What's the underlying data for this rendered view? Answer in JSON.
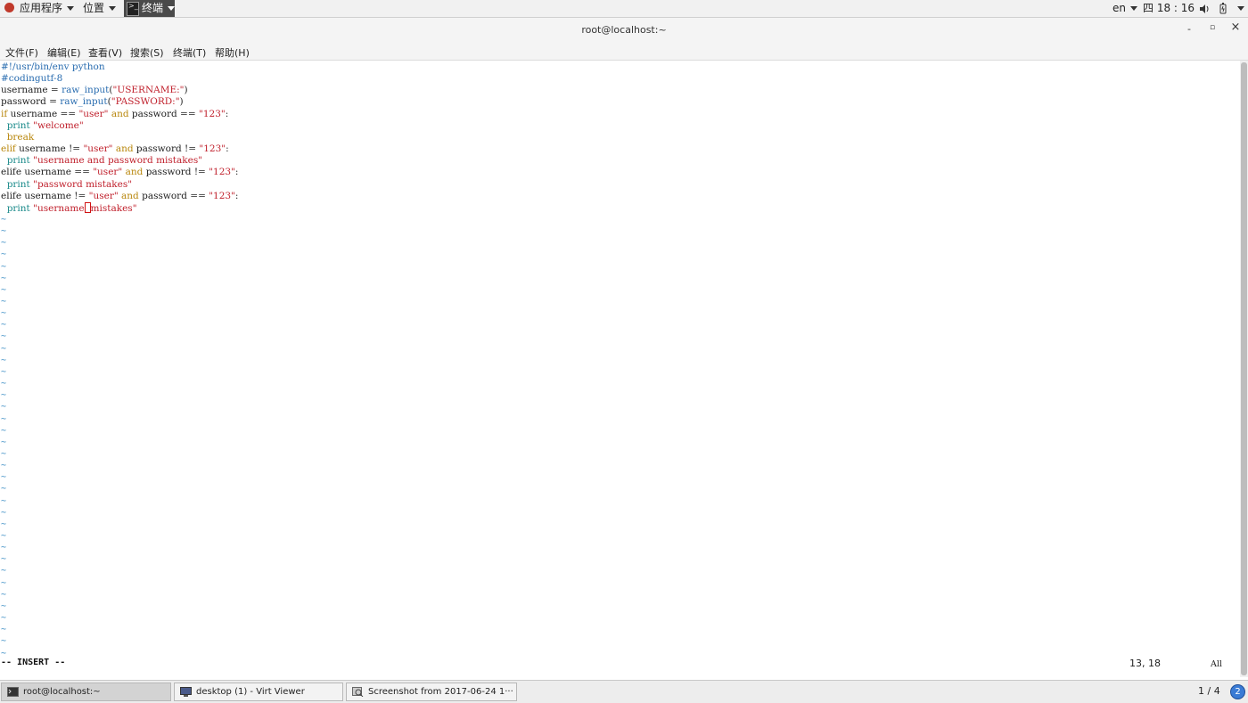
{
  "top_panel": {
    "applications_label": "应用程序",
    "places_label": "位置",
    "terminal_label": "终端",
    "language": "en",
    "clock": "四 18 : 16",
    "icons": [
      "volume-icon",
      "power-icon",
      "dropdown-icon"
    ]
  },
  "window": {
    "title": "root@localhost:~",
    "minimize": "-",
    "maximize": "▫",
    "close": "×"
  },
  "menubar": {
    "items": [
      "文件(F)",
      "编辑(E)",
      "查看(V)",
      "搜索(S)",
      "终端(T)",
      "帮助(H)"
    ]
  },
  "editor": {
    "lines": [
      "#!/usr/bin/env python",
      "#codingutf-8",
      "username = raw_input(\"USERNAME:\")",
      "password = raw_input(\"PASSWORD:\")",
      "if username == \"user\" and password == \"123\":",
      "  print \"welcome\"",
      "  break",
      "elif username != \"user\" and password != \"123\":",
      "  print \"username and password mistakes\"",
      "elife username == \"user\" and password != \"123\":",
      "  print \"password mistakes\"",
      "elife username != \"user\" and password == \"123\":",
      "  print \"username mistakes\""
    ],
    "tilde": "~",
    "tilde_count": 38
  },
  "status": {
    "mode": "-- INSERT --",
    "position": "13, 18",
    "scroll": "All"
  },
  "taskbar": {
    "tasks": [
      {
        "label": "root@localhost:~",
        "active": true
      },
      {
        "label": "desktop (1) - Virt Viewer",
        "active": false
      },
      {
        "label": "Screenshot from 2017-06-24 1···",
        "active": false
      }
    ],
    "workspace": "1 / 4",
    "badge": "2"
  }
}
